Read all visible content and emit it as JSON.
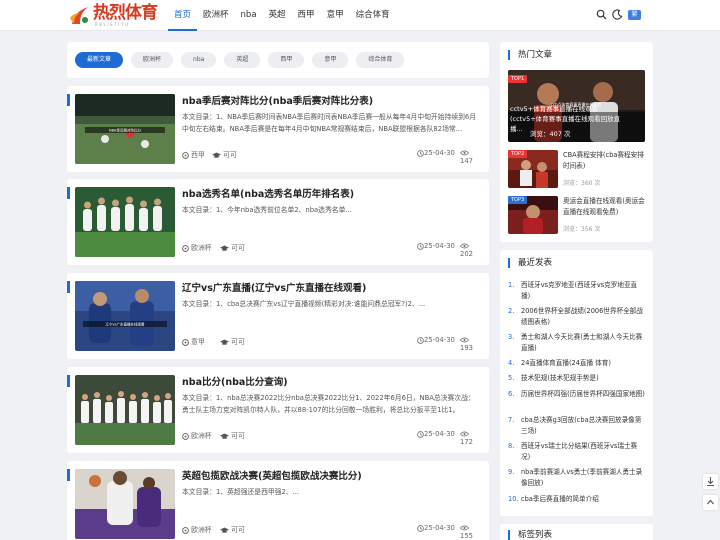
{
  "header": {
    "logo_text": "热烈体育",
    "logo_sub": "RELIETIYU",
    "nav": [
      "首页",
      "欧洲杯",
      "nba",
      "英超",
      "西甲",
      "意甲",
      "综合体育"
    ],
    "active_nav": 0,
    "lang_button": "繁"
  },
  "tabs": [
    "最新文章",
    "欧洲杯",
    "nba",
    "英超",
    "西甲",
    "意甲",
    "综合体育"
  ],
  "posts": [
    {
      "title": "nba季后赛对阵比分(nba季后赛对阵比分表)",
      "desc": "本文目录：1、NBA季后赛时间表NBA季后赛时间表NBA季后赛一般从每年4月中旬开始持续到6月中旬左右结束。NBA季后赛是在每年4月中旬NBA常规赛结束后，NBA联盟根据各队82场常...",
      "category": "西甲",
      "ok": "可可",
      "date": "25-04-30",
      "views": "147"
    },
    {
      "title": "nba选秀名单(nba选秀名单历年排名表)",
      "desc": "本文目录：1、今年nba选秀前位名单2、nba选秀名单...",
      "category": "欧洲杯",
      "ok": "可可",
      "date": "25-04-30",
      "views": "202"
    },
    {
      "title": "辽宁vs广东直播(辽宁vs广东直播在线观看)",
      "desc": "本文目录：1、cba总决赛广东vs辽宁直播视频(精彩对决:谁能问鼎总冠军?)2、...",
      "category": "意甲",
      "ok": "可可",
      "date": "25-04-30",
      "views": "193"
    },
    {
      "title": "nba比分(nba比分查询)",
      "desc": "本文目录：1、nba总决赛2022比分nba总决赛2022比分1、2022年6月6日，NBA总决赛次战：勇士队主场力克对阵凯尔特人队，并以88-107的比分回敬一场胜利，将总比分扳平至1比1。 202...",
      "category": "欧洲杯",
      "ok": "可可",
      "date": "25-04-30",
      "views": "172"
    },
    {
      "title": "英超包揽欧战决赛(英超包揽欧战决赛比分)",
      "desc": "本文目录：1、英超强还是西甲强2、...",
      "category": "欧洲杯",
      "ok": "可可",
      "date": "25-04-30",
      "views": "155"
    }
  ],
  "hot": {
    "heading": "热门文章",
    "items": [
      {
        "tag": "TOP1",
        "title": "cctv5+体育赛事直播在线观看(cctv5+体育赛事直播在线观看回放直播...",
        "views": "浏览：407 次",
        "thumb_caption": "cctv5体育赛事直播在线观看"
      },
      {
        "tag": "TOP2",
        "title": "CBA赛程安排(cba赛程安排时间表)",
        "views": "浏览：360 次"
      },
      {
        "tag": "TOP3",
        "title": "奥运会直播在线观看(奥运会直播在线观看免费)",
        "views": "浏览：356 次"
      }
    ]
  },
  "latest": {
    "heading": "最近发表",
    "items": [
      {
        "num": "1.",
        "text": "西班牙vs克罗地亚(西班牙vs克罗地亚直播)"
      },
      {
        "num": "2.",
        "text": "2006世界杯全部战绩(2006世界杯全部战绩图表格)"
      },
      {
        "num": "3.",
        "text": "勇士和湖人今天比赛(勇士和湖人今天比赛直播)"
      },
      {
        "num": "4.",
        "text": "24直播体育直播(24直播 体育)"
      },
      {
        "num": "5.",
        "text": "技术犯规(技术犯规手势是)"
      },
      {
        "num": "6.",
        "text": "历届世界杯四强(历届世界杯四强国家地图)"
      },
      {
        "num": "7.",
        "text": "cba总决赛g3回放(cba总决赛回放录像第三场)"
      },
      {
        "num": "8.",
        "text": "西班牙vs瑞士比分结果(西班牙vs瑞士赛况)"
      },
      {
        "num": "9.",
        "text": "nba季前赛湖人vs勇士(季前赛湖人勇士录像回放)"
      },
      {
        "num": "10.",
        "text": "cba季后赛直播的简单介绍"
      }
    ]
  },
  "tags_heading": "标签列表",
  "post_thumb_captions": [
    "NBA季后赛对阵比分",
    "",
    "辽宁vs广东直播在线观看",
    "",
    ""
  ],
  "colors": {
    "accent": "#1e6bd6",
    "logo_red": "#d63b1f",
    "top_tag": "#e33333"
  }
}
